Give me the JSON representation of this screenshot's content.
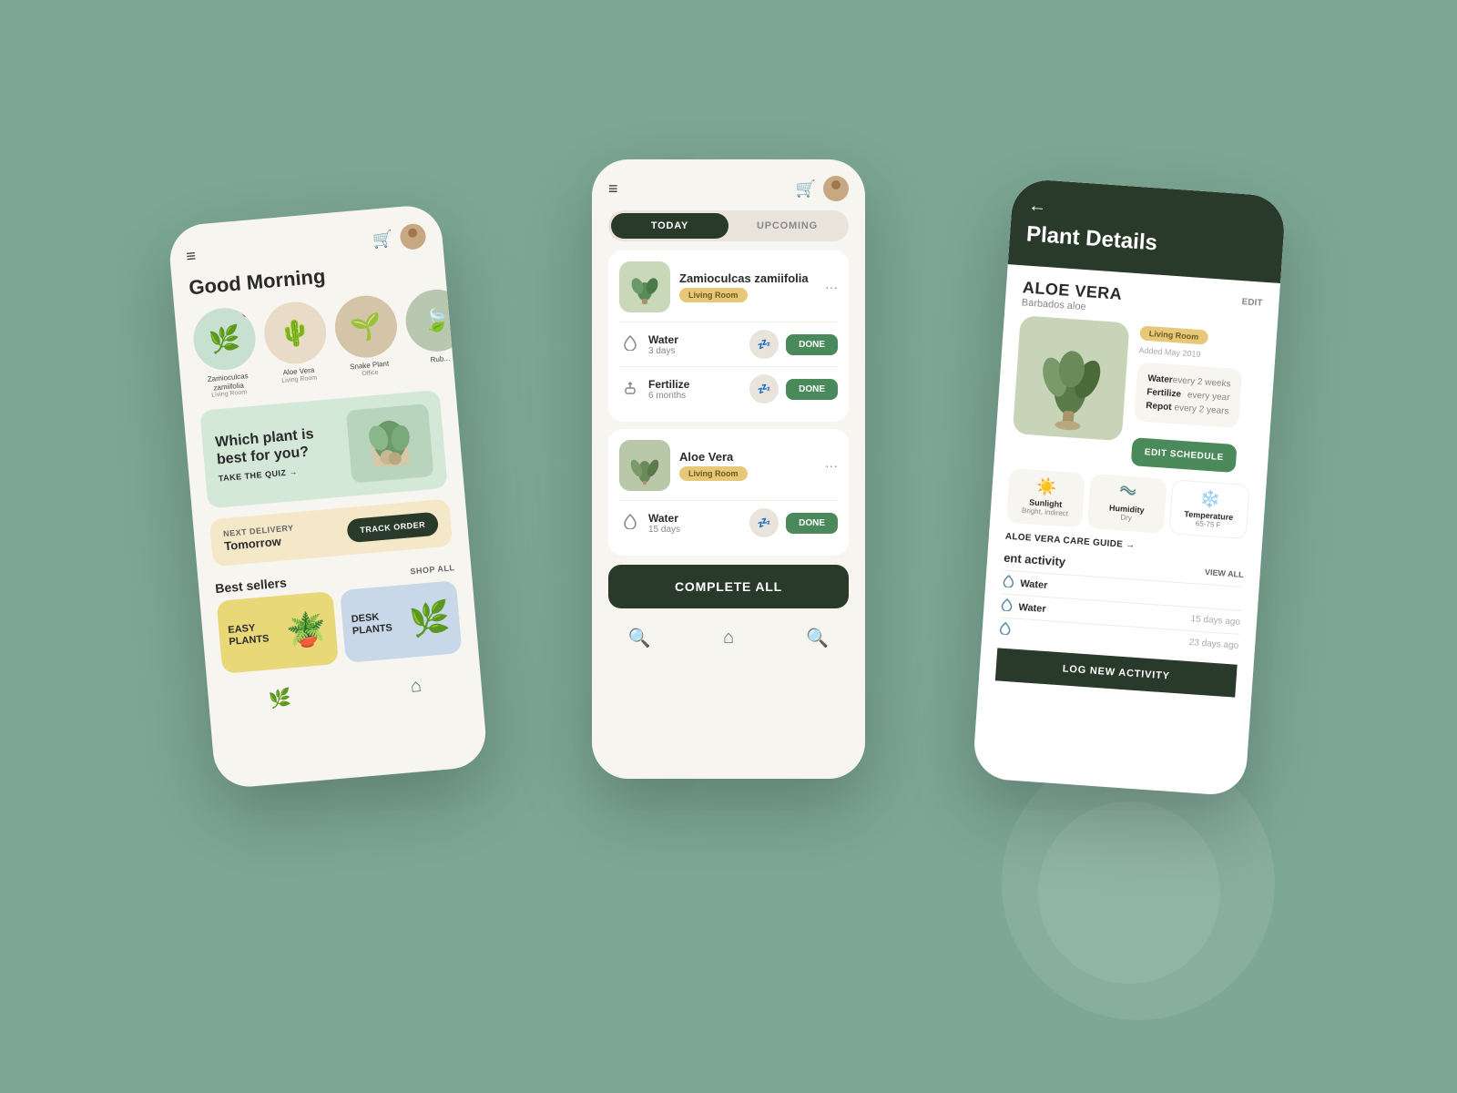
{
  "background": "#7da896",
  "phones": {
    "left": {
      "greeting": "Good Morning",
      "plants": [
        {
          "name": "Zamioculcas zamiifolia",
          "location": "Living Room",
          "color": "green",
          "emoji": "🌿",
          "has_notification": true
        },
        {
          "name": "Aloe Vera",
          "location": "Living Room",
          "color": "beige",
          "emoji": "🌵",
          "has_notification": false
        },
        {
          "name": "Snake Plant",
          "location": "Office",
          "color": "tan",
          "emoji": "🌱",
          "has_notification": false
        },
        {
          "name": "Rub...",
          "location": "",
          "color": "sage",
          "emoji": "🍃",
          "has_notification": false
        }
      ],
      "quiz_banner": {
        "heading_line1": "Which plant is",
        "heading_line2": "best for you?",
        "cta": "TAKE THE QUIZ →"
      },
      "delivery_banner": {
        "label": "NEXT DELIVERY",
        "value": "Tomorrow",
        "button": "TRACK ORDER"
      },
      "best_sellers_label": "Best sellers",
      "shop_all": "SHOP ALL",
      "sellers": [
        {
          "label": "EASY PLANTS",
          "color": "yellow",
          "emoji": "🪴"
        },
        {
          "label": "DESK PLANTS",
          "color": "blue",
          "emoji": "🌿"
        }
      ],
      "nav": [
        "🌿",
        "🏠"
      ]
    },
    "center": {
      "tabs": [
        {
          "label": "TODAY",
          "active": true
        },
        {
          "label": "UPCOMING",
          "active": false
        }
      ],
      "plant_cards": [
        {
          "name": "Zamioculcas zamiifolia",
          "room": "Living Room",
          "emoji": "🌿",
          "tasks": [
            {
              "icon": "💧",
              "name": "Water",
              "freq": "3 days"
            },
            {
              "icon": "🌱",
              "name": "Fertilize",
              "freq": "6 months"
            }
          ]
        },
        {
          "name": "Aloe Vera",
          "room": "Living Room",
          "emoji": "🌵",
          "tasks": [
            {
              "icon": "💧",
              "name": "Water",
              "freq": "15 days"
            }
          ]
        }
      ],
      "complete_all_label": "COMPLETE ALL",
      "nav": [
        "🏠",
        "🔍"
      ]
    },
    "right": {
      "back_label": "←",
      "title": "Plant Details",
      "plant_name": "ALOE VERA",
      "plant_subtitle": "Barbados aloe",
      "room": "Living Room",
      "added": "Added May 2019",
      "edit_label": "EDIT",
      "schedule": [
        {
          "label": "Water",
          "value": "every 2 weeks"
        },
        {
          "label": "Fertilize",
          "value": "every year"
        },
        {
          "label": "Repot",
          "value": "every 2 years"
        }
      ],
      "edit_schedule_btn": "EDIT SCHEDULE",
      "conditions": [
        {
          "icon": "☀️",
          "name": "Sunlight",
          "value": "Bright, indirect"
        },
        {
          "icon": "〰️",
          "name": "Humidity",
          "value": "Dry"
        },
        {
          "icon": "❄️",
          "name": "Temperature",
          "value": "65-75 F"
        }
      ],
      "care_guide": "ALOE VERA CARE GUIDE →",
      "activity_title": "ent activity",
      "view_all": "VIEW ALL",
      "activities": [
        {
          "icon": "💧",
          "name": "Water",
          "time": ""
        },
        {
          "icon": "💧",
          "name": "Water",
          "time": "15 days ago"
        },
        {
          "icon": "💧",
          "name": "",
          "time": "23 days ago"
        }
      ],
      "log_btn": "LOG NEW ACTIVITY"
    }
  }
}
